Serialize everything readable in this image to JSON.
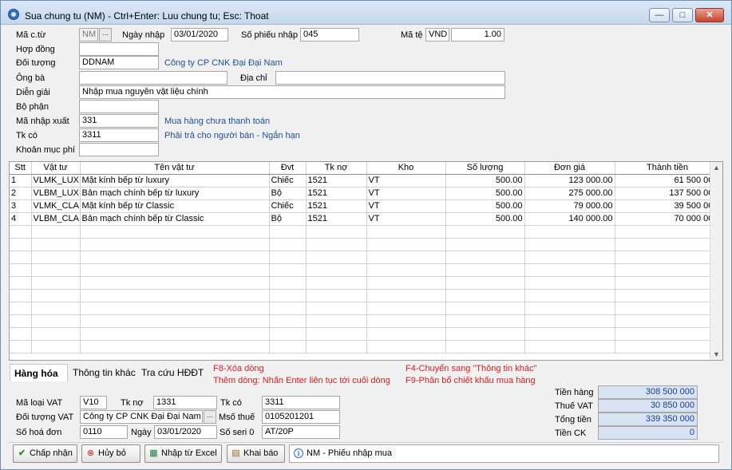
{
  "window": {
    "title": "Sua chung tu (NM) - Ctrl+Enter: Luu chung tu; Esc: Thoat",
    "minimize_glyph": "—",
    "restore_glyph": "□",
    "close_glyph": "✕"
  },
  "header": {
    "ma_ct_label": "Mã c.từ",
    "ma_ct_value": "NM",
    "ma_ct_btn": "...",
    "ngay_nhap_label": "Ngày nhập",
    "ngay_nhap_value": "03/01/2020",
    "so_phieu_label": "Số phiếu nhập",
    "so_phieu_value": "045",
    "ma_te_label": "Mã tệ",
    "ma_te_value": "VND",
    "ty_gia_value": "1.00",
    "hop_dong_label": "Hợp đồng",
    "hop_dong_value": "",
    "doi_tuong_label": "Đối tượng",
    "doi_tuong_value": "DDNAM",
    "doi_tuong_name": "Công ty CP CNK Đại Đại Nam",
    "ong_ba_label": "Ông bà",
    "ong_ba_value": "",
    "dia_chi_label": "Địa chỉ",
    "dia_chi_value": "",
    "dien_giai_label": "Diễn giải",
    "dien_giai_value": "Nhập mua nguyên vật liệu chính",
    "bo_phan_label": "Bộ phận",
    "bo_phan_value": "",
    "ma_nhap_xuat_label": "Mã nhập xuất",
    "ma_nhap_xuat_value": "331",
    "ma_nhap_xuat_name": "Mua hàng chưa thanh toán",
    "tk_co_label": "Tk có",
    "tk_co_value": "3311",
    "tk_co_name": "Phải trả cho người bán - Ngắn hạn",
    "khoan_muc_phi_label": "Khoản mục phí",
    "khoan_muc_phi_value": ""
  },
  "grid": {
    "columns": [
      "Stt",
      "Vật tư",
      "Tên vật tư",
      "Đvt",
      "Tk nợ",
      "Kho",
      "Số lượng",
      "Đơn giá",
      "Thành tiền",
      ">>"
    ],
    "rows": [
      [
        "1",
        "VLMK_LUX",
        "Mặt kính bếp từ luxury",
        "Chiếc",
        "1521",
        "VT",
        "500.00",
        "123 000.00",
        "61 500 000"
      ],
      [
        "2",
        "VLBM_LUX",
        "Bản mạch chính bếp từ luxury",
        "Bộ",
        "1521",
        "VT",
        "500.00",
        "275 000.00",
        "137 500 000"
      ],
      [
        "3",
        "VLMK_CLA",
        "Mặt kính bếp từ Classic",
        "Chiếc",
        "1521",
        "VT",
        "500.00",
        "79 000.00",
        "39 500 000"
      ],
      [
        "4",
        "VLBM_CLA",
        "Bản mạch chính bếp từ Classic",
        "Bộ",
        "1521",
        "VT",
        "500.00",
        "140 000.00",
        "70 000 000"
      ]
    ],
    "scroll_up": "▲",
    "scroll_down": "▼"
  },
  "tabs": [
    "Hàng hóa",
    "Thông tin khác",
    "Tra cứu HĐĐT"
  ],
  "hints": {
    "f8": "F8-Xóa dòng",
    "add_row": "Thêm dòng: Nhấn Enter liên tục tới cuối dòng",
    "f4": "F4-Chuyển sang \"Thông tin khác\"",
    "f9": "F9-Phân bổ chiết khấu mua hàng"
  },
  "vat": {
    "ma_loai_vat_label": "Mã loại VAT",
    "ma_loai_vat_value": "V10",
    "tk_no_label": "Tk nợ",
    "tk_no_value": "1331",
    "tk_co_label": "Tk có",
    "tk_co_value": "3311",
    "doi_tuong_vat_label": "Đối tượng VAT",
    "doi_tuong_vat_value": "Công ty CP CNK Đại Đại Nam",
    "doi_tuong_vat_btn": "...",
    "mst_label": "Msố thuế",
    "mst_value": "0105201201",
    "so_hoa_don_label": "Số hoá đơn",
    "so_hoa_don_value": "0110",
    "ngay_label": "Ngày",
    "ngay_value": "03/01/2020",
    "so_seri_label": "Số seri 0",
    "so_seri_value": "AT/20P"
  },
  "totals": {
    "tien_hang_label": "Tiền hàng",
    "tien_hang_value": "308 500 000",
    "thue_vat_label": "Thuế VAT",
    "thue_vat_value": "30 850 000",
    "tong_tien_label": "Tổng tiền",
    "tong_tien_value": "339 350 000",
    "tien_ck_label": "Tiền CK",
    "tien_ck_value": "0"
  },
  "buttons": {
    "chap_nhan": "Chấp nhận",
    "huy_bo": "Hủy bỏ",
    "nhap_excel": "Nhập từ Excel",
    "khai_bao": "Khai báo"
  },
  "status_text": "NM - Phiếu nhập mua"
}
